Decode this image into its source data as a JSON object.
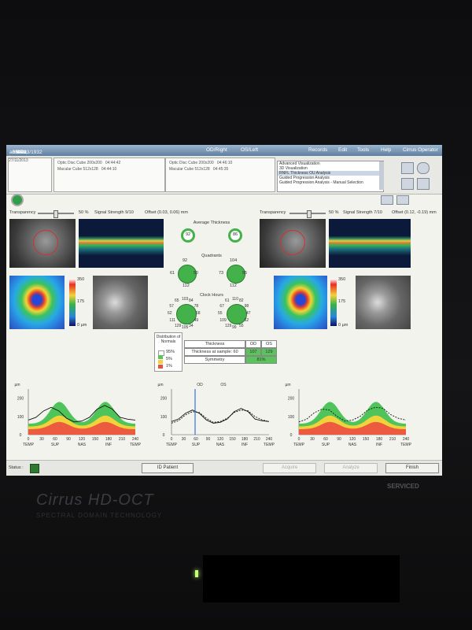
{
  "titlebar": {
    "patient": "abdalla, joe",
    "patient_id": "83429",
    "sex": "Male",
    "dob": "23/03/1932",
    "od_label": "OD/Right",
    "os_label": "OS/Left",
    "menu": [
      "Records",
      "Edit",
      "Tools",
      "Help",
      "Cirrus Operator"
    ]
  },
  "header": {
    "date": "27/11/2013",
    "od_scans": [
      "Optic Disc Cube 200x200",
      "Macular Cube 512x128"
    ],
    "od_times": [
      "04:44:42",
      "04:44:10"
    ],
    "os_scans": [
      "Optic Disc Cube 200x200",
      "Macular Cube 512x128"
    ],
    "os_times": [
      "04:46:10",
      "04:45:35"
    ],
    "analysis_list": [
      "Advanced Visualization",
      "3D Visualization",
      "RNFL Thickness OU Analysis",
      "Guided Progression Analysis",
      "Guided Progression Analysis - Manual Selection"
    ],
    "analysis_selected": 2
  },
  "od": {
    "transparency_label": "Transparency",
    "transparency": "50 %",
    "signal": "Signal Strength 9/10",
    "offset": "Offset (0.03, 0.06) mm"
  },
  "os": {
    "transparency_label": "Transparency",
    "transparency": "50 %",
    "signal": "Signal Strength 7/10",
    "offset": "Offset (0.12, -0.19) mm"
  },
  "center": {
    "avg_title": "Average Thickness",
    "avg_od": "92",
    "avg_os": "86",
    "quad_title": "Quadrants",
    "quad_od": {
      "top": "92",
      "left": "61",
      "right": "50",
      "bottom": "112"
    },
    "quad_os": {
      "top": "104",
      "left": "73",
      "right": "55",
      "bottom": "112"
    },
    "clock_title": "Clock Hours",
    "clock_od": [
      "103",
      "84",
      "78",
      "68",
      "49",
      "34",
      "105",
      "129",
      "111",
      "62",
      "57",
      "65"
    ],
    "clock_os": [
      "110",
      "82",
      "98",
      "47",
      "62",
      "55",
      "99",
      "129",
      "109",
      "55",
      "67",
      "61"
    ]
  },
  "scale": {
    "top": "350",
    "mid": "175",
    "bottom": "0 µm"
  },
  "table": {
    "dist_title": "Distribution of Normals",
    "legend": [
      "95%",
      "5%",
      "1%"
    ],
    "header": [
      "Thickness",
      "OD",
      "OS"
    ],
    "rows": [
      {
        "label": "Thickness at sample: 60",
        "od": "107",
        "os": "129"
      },
      {
        "label": "Symmetry",
        "od": "",
        "os": "81%"
      }
    ]
  },
  "charts": {
    "unit": "µm",
    "yticks": [
      "200",
      "100",
      "0"
    ],
    "xticks": [
      "0",
      "30",
      "60",
      "90",
      "120",
      "150",
      "180",
      "210",
      "240"
    ],
    "regions": [
      "TEMP",
      "SUP",
      "NAS",
      "INF",
      "TEMP"
    ],
    "od_label": "OD",
    "os_label": "OS"
  },
  "statusbar": {
    "status_label": "Status :",
    "id_patient": "ID Patient",
    "acquire": "Acquire",
    "analyze": "Analyze",
    "finish": "Finish"
  },
  "bezel": {
    "brand": "Cirrus HD-OCT",
    "tagline": "SPECTRAL DOMAIN TECHNOLOGY",
    "sticker_title": "SERVICED"
  }
}
